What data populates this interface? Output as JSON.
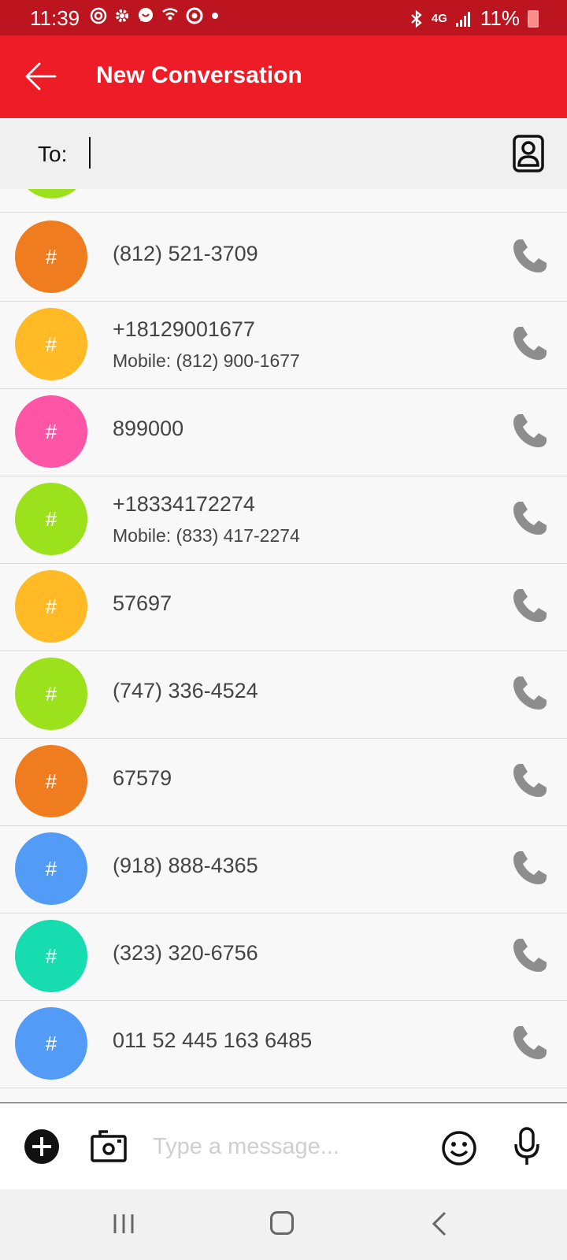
{
  "status_bar": {
    "time": "11:39",
    "network": "4G",
    "battery": "11%",
    "icons": [
      "target-icon",
      "gear-icon",
      "chat-bubble-icon",
      "wifi-call-icon",
      "chrome-icon",
      "dot-icon",
      "bluetooth-icon",
      "signal-icon",
      "battery-icon"
    ]
  },
  "app_bar": {
    "title": "New Conversation",
    "background": "#ee1c27",
    "status_background": "#bd1520"
  },
  "to_field": {
    "label": "To:",
    "value": ""
  },
  "contacts": [
    {
      "avatar": "#",
      "color": "#f07c20",
      "primary": "(812) 521-3709",
      "secondary": ""
    },
    {
      "avatar": "#",
      "color": "#ffba26",
      "primary": "+18129001677",
      "secondary": "Mobile: (812) 900-1677"
    },
    {
      "avatar": "#",
      "color": "#ff55a6",
      "primary": "899000",
      "secondary": ""
    },
    {
      "avatar": "#",
      "color": "#9be21d",
      "primary": "+18334172274",
      "secondary": "Mobile: (833) 417-2274"
    },
    {
      "avatar": "#",
      "color": "#ffba26",
      "primary": "57697",
      "secondary": ""
    },
    {
      "avatar": "#",
      "color": "#9be21d",
      "primary": "(747) 336-4524",
      "secondary": ""
    },
    {
      "avatar": "#",
      "color": "#f07c20",
      "primary": "67579",
      "secondary": ""
    },
    {
      "avatar": "#",
      "color": "#529cf7",
      "primary": "(918) 888-4365",
      "secondary": ""
    },
    {
      "avatar": "#",
      "color": "#17dcb0",
      "primary": "(323) 320-6756",
      "secondary": ""
    },
    {
      "avatar": "#",
      "color": "#529cf7",
      "primary": "011 52 445 163 6485",
      "secondary": ""
    }
  ],
  "partial_contact_color": "#9be21d",
  "composer": {
    "placeholder": "Type a message..."
  }
}
